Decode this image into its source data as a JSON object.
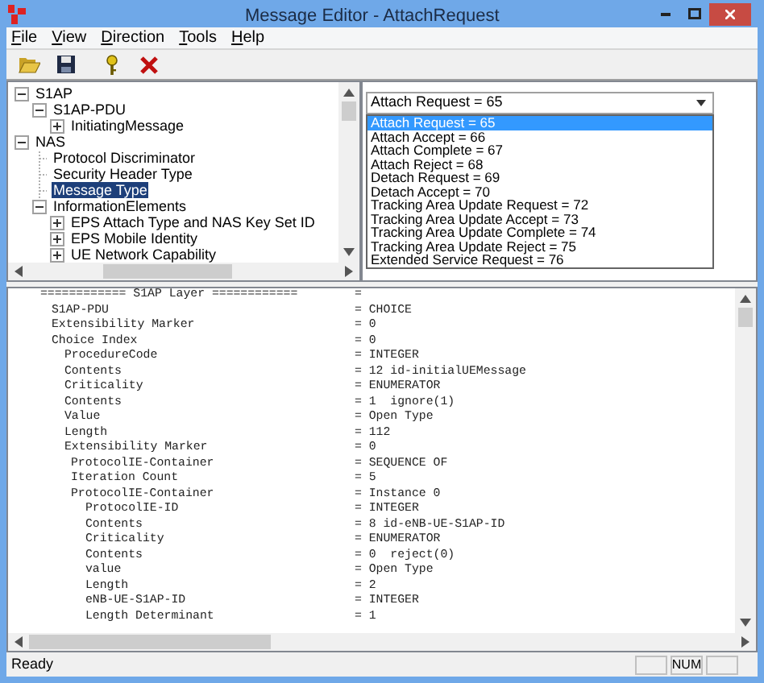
{
  "window": {
    "title": "Message Editor - AttachRequest"
  },
  "menu": [
    "File",
    "View",
    "Direction",
    "Tools",
    "Help"
  ],
  "toolbar": [
    {
      "kind": "open"
    },
    {
      "kind": "save"
    },
    {
      "kind": "help"
    },
    {
      "kind": "delete"
    }
  ],
  "tree": [
    {
      "label": "S1AP",
      "expanded": true,
      "selected": false,
      "children": [
        {
          "label": "S1AP-PDU",
          "expanded": true,
          "selected": false,
          "children": [
            {
              "label": "InitiatingMessage",
              "expanded": false,
              "selected": false
            }
          ]
        }
      ]
    },
    {
      "label": "NAS",
      "expanded": true,
      "selected": false,
      "children": [
        {
          "label": "Protocol Discriminator",
          "selected": false
        },
        {
          "label": "Security Header Type",
          "selected": false
        },
        {
          "label": "Message Type",
          "selected": true
        },
        {
          "label": "InformationElements",
          "expanded": true,
          "selected": false,
          "children": [
            {
              "label": "EPS Attach Type and NAS Key Set ID",
              "expanded": false,
              "selected": false
            },
            {
              "label": "EPS Mobile Identity",
              "expanded": false,
              "selected": false
            },
            {
              "label": "UE Network Capability",
              "expanded": false,
              "selected": false
            }
          ]
        }
      ]
    }
  ],
  "message_type": {
    "value": "Attach Request = 65",
    "options": [
      {
        "label": "Attach Request = 65",
        "selected": true
      },
      {
        "label": "Attach Accept = 66",
        "selected": false
      },
      {
        "label": "Attach Complete = 67",
        "selected": false
      },
      {
        "label": "Attach Reject = 68",
        "selected": false
      },
      {
        "label": "Detach Request = 69",
        "selected": false
      },
      {
        "label": "Detach Accept = 70",
        "selected": false
      },
      {
        "label": "Tracking Area Update Request = 72",
        "selected": false
      },
      {
        "label": "Tracking Area Update Accept = 73",
        "selected": false
      },
      {
        "label": "Tracking Area Update Complete = 74",
        "selected": false
      },
      {
        "label": "Tracking Area Update Reject = 75",
        "selected": false
      },
      {
        "label": "Extended Service Request = 76",
        "selected": false
      }
    ]
  },
  "listing": [
    {
      "kind": "header",
      "name": "============ S1AP Layer ============",
      "value": "="
    },
    {
      "kind": "field",
      "name": "S1AP-PDU",
      "value": "= CHOICE"
    },
    {
      "kind": "field",
      "name": "Extensibility Marker",
      "value": "= 0"
    },
    {
      "kind": "field",
      "name": "Choice Index",
      "value": "= 0",
      "children": [
        {
          "kind": "field",
          "name": "ProcedureCode",
          "value": "= INTEGER"
        },
        {
          "kind": "field",
          "name": "Contents",
          "value": "= 12 id-initialUEMessage"
        },
        {
          "kind": "field",
          "name": "Criticality",
          "value": "= ENUMERATOR"
        },
        {
          "kind": "field",
          "name": "Contents",
          "value": "= 1  ignore(1)"
        },
        {
          "kind": "field",
          "name": "Value",
          "value": "= Open Type"
        },
        {
          "kind": "field",
          "name": "Length",
          "value": "= 112"
        },
        {
          "kind": "field",
          "name": "Extensibility Marker",
          "value": "= 0",
          "children": [
            {
              "kind": "field",
              "name": "ProtocolIE-Container",
              "value": "= SEQUENCE OF"
            },
            {
              "kind": "field",
              "name": "Iteration Count",
              "value": "= 5"
            },
            {
              "kind": "field",
              "name": "ProtocolIE-Container",
              "value": "= Instance 0",
              "children": [
                {
                  "kind": "field",
                  "name": "ProtocolIE-ID",
                  "value": "= INTEGER"
                },
                {
                  "kind": "field",
                  "name": "Contents",
                  "value": "= 8 id-eNB-UE-S1AP-ID"
                },
                {
                  "kind": "field",
                  "name": "Criticality",
                  "value": "= ENUMERATOR"
                },
                {
                  "kind": "field",
                  "name": "Contents",
                  "value": "= 0  reject(0)"
                },
                {
                  "kind": "field",
                  "name": "value",
                  "value": "= Open Type"
                },
                {
                  "kind": "field",
                  "name": "Length",
                  "value": "= 2"
                },
                {
                  "kind": "field",
                  "name": "eNB-UE-S1AP-ID",
                  "value": "= INTEGER"
                },
                {
                  "kind": "field",
                  "name": "Length Determinant",
                  "value": "= 1"
                }
              ]
            }
          ]
        }
      ]
    }
  ],
  "status_bar": {
    "text": "Ready",
    "panels": [
      {
        "kind": "blank"
      },
      {
        "kind": "text",
        "text": "NUM"
      },
      {
        "kind": "blank"
      }
    ]
  }
}
